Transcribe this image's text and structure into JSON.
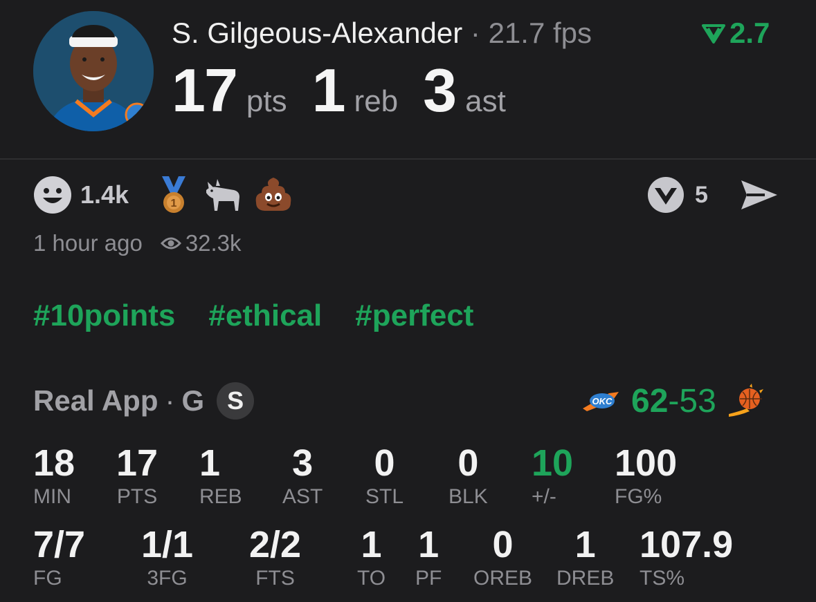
{
  "player": {
    "name": "S. Gilgeous-Alexander",
    "separator": "·",
    "fps": "21.7 fps",
    "rating": "2.7",
    "points": "17",
    "points_unit": "pts",
    "rebounds": "1",
    "rebounds_unit": "reb",
    "assists": "3",
    "assists_unit": "ast"
  },
  "reactions": {
    "count": "1.4k",
    "emoji_icons": [
      "smiley-face-icon",
      "bronze-medal-icon",
      "goat-icon",
      "poop-icon"
    ],
    "comment_count": "5"
  },
  "meta": {
    "time": "1 hour ago",
    "views": "32.3k"
  },
  "hashtags": [
    "#10points",
    "#ethical",
    "#perfect"
  ],
  "source": {
    "name": "Real App",
    "separator": "·",
    "position": "G",
    "badge": "S"
  },
  "game": {
    "home_score": "62",
    "dash": "-",
    "away_score": "53",
    "home_team_icon": "okc-thunder-logo-icon",
    "away_team_icon": "phoenix-suns-logo-icon"
  },
  "stats_row1": [
    {
      "value": "18",
      "label": "MIN"
    },
    {
      "value": "17",
      "label": "PTS"
    },
    {
      "value": "1",
      "label": "REB"
    },
    {
      "value": "3",
      "label": "AST"
    },
    {
      "value": "0",
      "label": "STL"
    },
    {
      "value": "0",
      "label": "BLK"
    },
    {
      "value": "10",
      "label": "+/-"
    },
    {
      "value": "100",
      "label": "FG%"
    }
  ],
  "stats_row2": [
    {
      "value": "7/7",
      "label": "FG"
    },
    {
      "value": "1/1",
      "label": "3FG"
    },
    {
      "value": "2/2",
      "label": "FTS"
    },
    {
      "value": "1",
      "label": "TO"
    },
    {
      "value": "1",
      "label": "PF"
    },
    {
      "value": "0",
      "label": "OREB"
    },
    {
      "value": "1",
      "label": "DREB"
    },
    {
      "value": "107.9",
      "label": "TS%"
    }
  ],
  "colors": {
    "accent": "#1ea45a",
    "background": "#1c1c1e",
    "muted": "#8e8e93"
  }
}
